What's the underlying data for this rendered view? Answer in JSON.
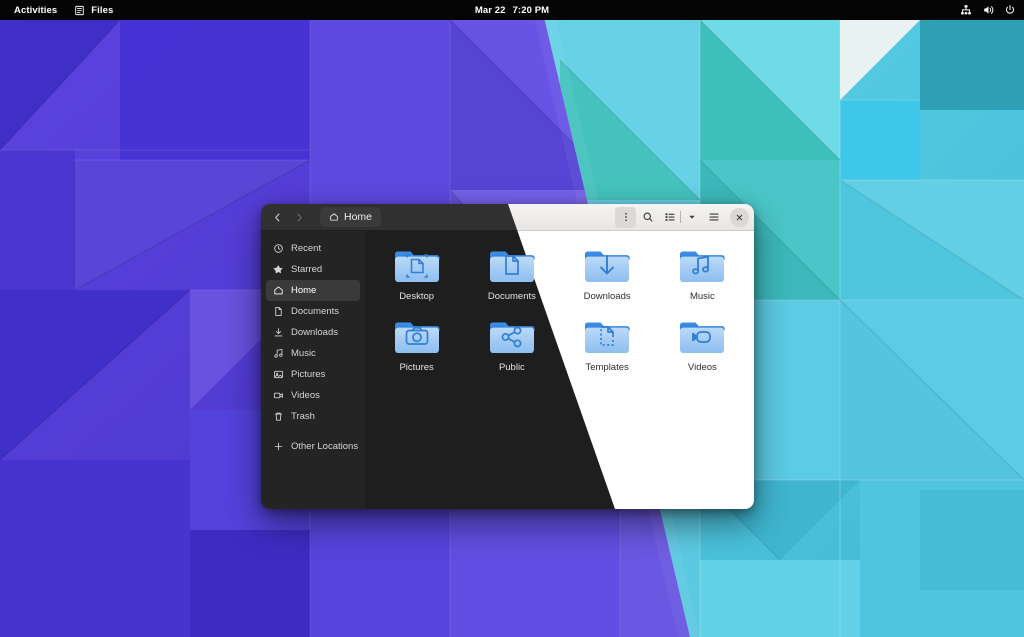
{
  "topbar": {
    "activities_label": "Activities",
    "app_label": "Files",
    "app_icon": "files-icon",
    "clock_date": "Mar 22",
    "clock_time": "7:20 PM",
    "icons": [
      {
        "name": "network-icon",
        "glyph": "network"
      },
      {
        "name": "volume-icon",
        "glyph": "volume"
      },
      {
        "name": "power-icon",
        "glyph": "power"
      }
    ],
    "bg_color": "#050505",
    "fg_color": "#ffffff"
  },
  "window": {
    "title": "Home",
    "pathbar_label": "Home",
    "pathbar_icon": "home-icon",
    "back_label": "Back",
    "forward_label": "Forward",
    "menu_label": "Menu",
    "search_label": "Search",
    "view_label": "View options",
    "view_dropdown_label": "View type",
    "hamburger_label": "Main menu",
    "close_label": "×",
    "theme_transition": "dark-to-light"
  },
  "sidebar": {
    "items": [
      {
        "label": "Recent",
        "icon": "clock-icon",
        "selected": false
      },
      {
        "label": "Starred",
        "icon": "star-icon",
        "selected": false
      },
      {
        "label": "Home",
        "icon": "home-icon",
        "selected": true
      },
      {
        "label": "Documents",
        "icon": "document-icon",
        "selected": false
      },
      {
        "label": "Downloads",
        "icon": "download-icon",
        "selected": false
      },
      {
        "label": "Music",
        "icon": "music-icon",
        "selected": false
      },
      {
        "label": "Pictures",
        "icon": "image-icon",
        "selected": false
      },
      {
        "label": "Videos",
        "icon": "video-icon",
        "selected": false
      },
      {
        "label": "Trash",
        "icon": "trash-icon",
        "selected": false
      }
    ],
    "other_locations": {
      "label": "Other Locations",
      "icon": "plus-icon"
    }
  },
  "files": [
    {
      "label": "Desktop",
      "emblem": "desktop-emblem"
    },
    {
      "label": "Documents",
      "emblem": "document-emblem"
    },
    {
      "label": "Downloads",
      "emblem": "download-emblem"
    },
    {
      "label": "Music",
      "emblem": "music-emblem"
    },
    {
      "label": "Pictures",
      "emblem": "camera-emblem"
    },
    {
      "label": "Public",
      "emblem": "share-emblem"
    },
    {
      "label": "Templates",
      "emblem": "template-emblem"
    },
    {
      "label": "Videos",
      "emblem": "video-emblem"
    }
  ],
  "theme": {
    "dark_header": "#303030",
    "dark_sidebar": "#242424",
    "dark_content": "#1e1e1e",
    "light_header": "#f0eeec",
    "light_sidebar": "#eceae8",
    "light_content": "#ffffff",
    "folder_blue": "#3584e4",
    "folder_light": "#a9cdf5"
  },
  "wallpaper": {
    "name": "geometric-triangles",
    "left_color": "#5b3fd6",
    "right_color": "#4ec3dd"
  }
}
